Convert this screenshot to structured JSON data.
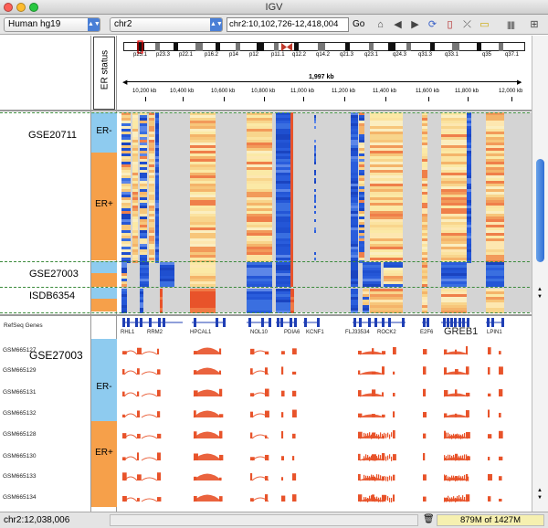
{
  "window": {
    "title": "IGV"
  },
  "toolbar": {
    "genome": "Human hg19",
    "chromosome": "chr2",
    "locus": "chr2:10,102,726-12,418,004",
    "go_label": "Go"
  },
  "ruler": {
    "span_label": "1,997 kb",
    "ticks": [
      "10,200 kb",
      "10,400 kb",
      "10,600 kb",
      "10,800 kb",
      "11,000 kb",
      "11,200 kb",
      "11,400 kb",
      "11,600 kb",
      "11,800 kb",
      "12,000 kb"
    ]
  },
  "ideogram": {
    "bands": [
      "p25.1",
      "p23.3",
      "p22.1",
      "p16.2",
      "p14",
      "p12",
      "p11.1",
      "q12.2",
      "q14.2",
      "q21.3",
      "q23.1",
      "q24.3",
      "q31.3",
      "q33.1",
      "q35",
      "q37.1"
    ]
  },
  "attribute": {
    "header": "ER status"
  },
  "groups": {
    "gse20711": "GSE20711",
    "gse27003": "GSE27003",
    "isdb6354": "ISDB6354",
    "gse27003_lower": "GSE27003"
  },
  "er_labels": {
    "neg": "ER-",
    "pos": "ER+",
    "neg_lower": "ER-",
    "pos_lower": "ER+"
  },
  "refseq": {
    "label": "RefSeq Genes",
    "genes": [
      "RHL1",
      "RRM2",
      "HPCAL1",
      "NOL10",
      "PDIA6",
      "KCNF1",
      "FLJ33534",
      "ROCK2",
      "E2F6",
      "GREB1",
      "LPIN1"
    ]
  },
  "samples": [
    "GSM665127",
    "GSM665129",
    "GSM665131",
    "GSM665132",
    "GSM665128",
    "GSM665130",
    "GSM665133",
    "GSM665134"
  ],
  "status": {
    "position": "chr2:12,038,006",
    "memory": "879M of 1427M"
  },
  "colors": {
    "er_neg": "#8ecbef",
    "er_pos": "#f6a04a",
    "blue": "#2456d6",
    "red": "#e8532a",
    "yellow": "#fbe9a6",
    "grey": "#d4d4d4"
  }
}
